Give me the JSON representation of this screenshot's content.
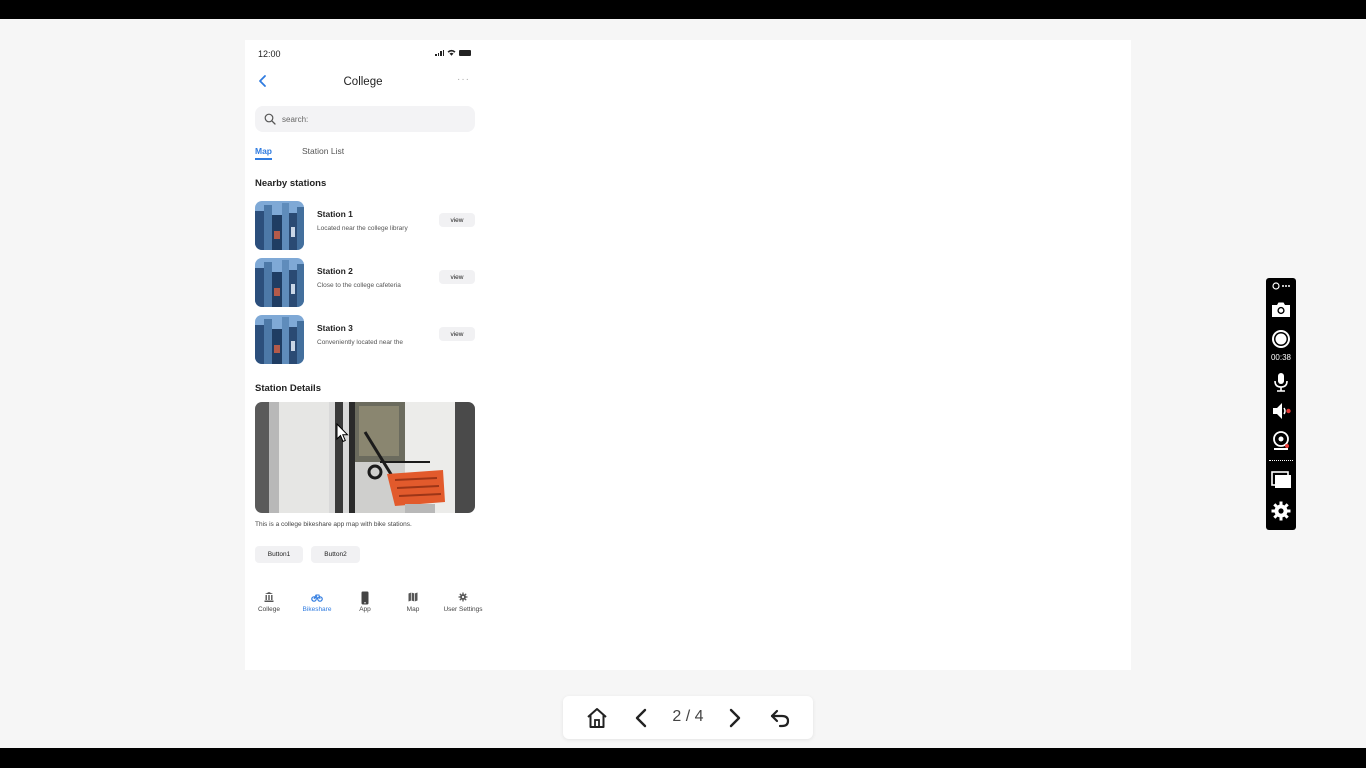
{
  "app": {
    "status_time": "12:00",
    "title": "College",
    "more": "···"
  },
  "search": {
    "placeholder": "search:"
  },
  "tabs": [
    {
      "label": "Map",
      "active": true
    },
    {
      "label": "Station List",
      "active": false
    }
  ],
  "nearby": {
    "heading": "Nearby stations",
    "stations": [
      {
        "name": "Station 1",
        "desc": "Located near the college library",
        "button": "view"
      },
      {
        "name": "Station 2",
        "desc": "Close to the college cafeteria",
        "button": "view"
      },
      {
        "name": "Station 3",
        "desc": "Conveniently located near the",
        "button": "view"
      }
    ]
  },
  "details": {
    "heading": "Station Details",
    "caption": "This is a college bikeshare app map with bike stations.",
    "button1": "Button1",
    "button2": "Button2"
  },
  "bottom_nav": [
    {
      "label": "College",
      "icon": "building-icon",
      "active": false
    },
    {
      "label": "Bikeshare",
      "icon": "bike-icon",
      "active": true
    },
    {
      "label": "App",
      "icon": "phone-icon",
      "active": false
    },
    {
      "label": "Map",
      "icon": "map-icon",
      "active": false
    },
    {
      "label": "User Settings",
      "icon": "gear-icon",
      "active": false
    }
  ],
  "recorder": {
    "timer": "00:38"
  },
  "pager": {
    "count": "2 / 4"
  },
  "colors": {
    "accent": "#2f7be0",
    "canvas": "#ffffff",
    "backdrop": "#f6f6f6"
  }
}
